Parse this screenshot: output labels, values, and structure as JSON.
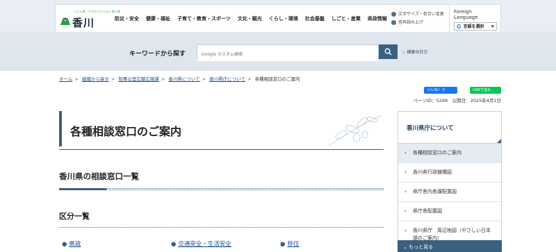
{
  "header": {
    "logo_tagline": "うどん県。それだけじゃない香川県",
    "logo_name": "香川県",
    "nav": [
      "防災・安全",
      "健康・福祉",
      "子育て・教育・スポーツ",
      "文化・観光",
      "くらし・環境",
      "社会基盤",
      "しごと・産業",
      "県政情報"
    ],
    "util": [
      "文字サイズ・色合い変更",
      "音声読み上げ"
    ],
    "foreign_label": "Foreign Language",
    "translate_label": "言語を選択"
  },
  "search": {
    "label": "キーワードから探す",
    "placeholder": "Google カスタム検索",
    "how_link": "検索の仕方"
  },
  "breadcrumb": {
    "items": [
      "ホーム",
      "組織から探す",
      "知事公室広聴広報課",
      "香川県について",
      "香川県庁について"
    ],
    "current": "各種相談窓口のご案内"
  },
  "share": {
    "facebook": "いいね！ 0",
    "line": "LINEで送る"
  },
  "page_info": "ページID：5299　公開日：2025年4月1日",
  "page_title": "各種相談窓口のご案内",
  "section_heading": "香川県の相談窓口一覧",
  "subsection_heading": "区分一覧",
  "categories": [
    "県政",
    "交通安全・生活安全",
    "移住"
  ],
  "sidebar": {
    "title": "香川県庁について",
    "items": [
      "各種相談窓口のご案内",
      "香川県行政機構図",
      "県庁舎内各課配置図",
      "県庁舎配置図",
      "香川県庁　周辺地図（やさしい日本語のご案内）"
    ],
    "more": "もっと見る"
  }
}
